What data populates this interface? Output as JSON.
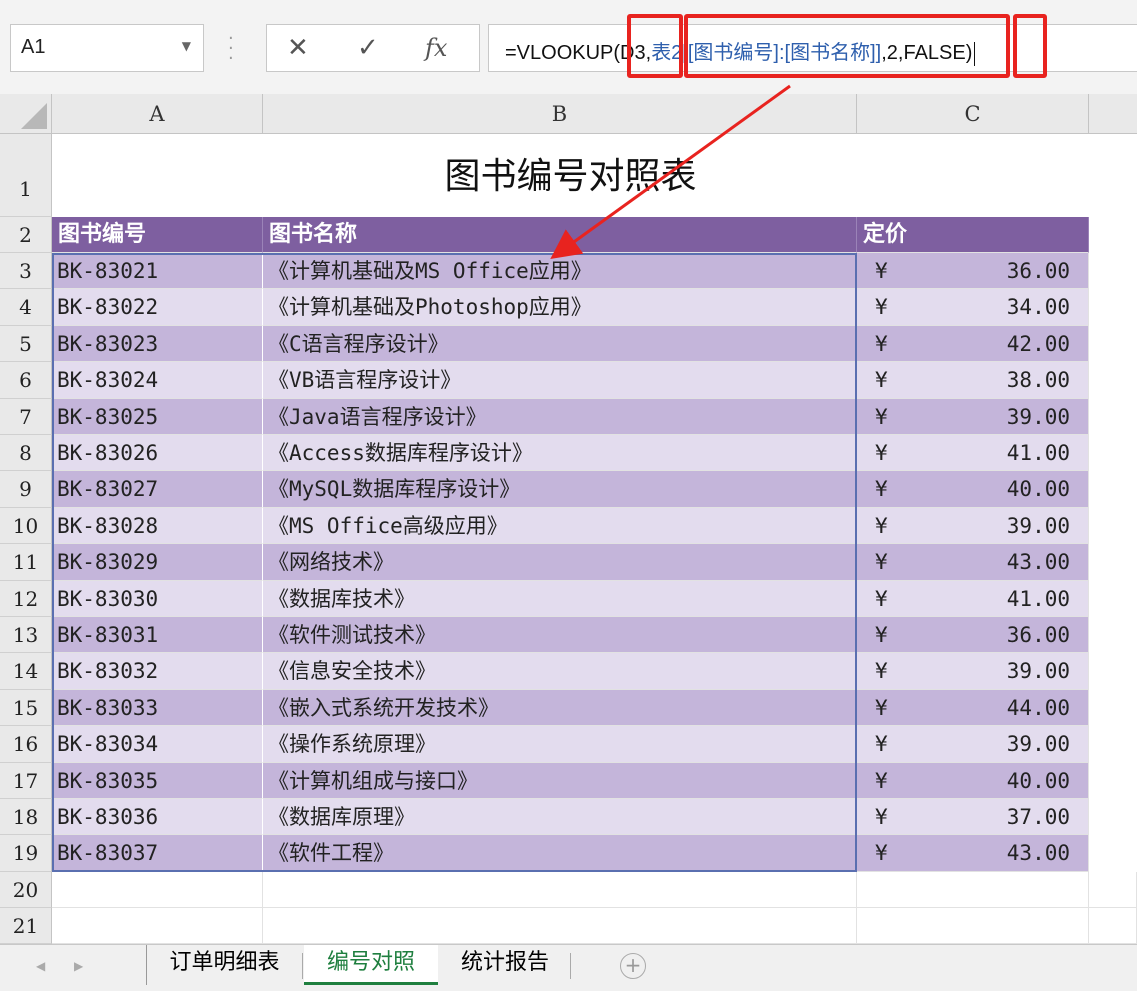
{
  "namebox": {
    "value": "A1",
    "dropdown": "▼"
  },
  "fx_buttons": {
    "cancel": "✕",
    "enter": "✓",
    "fx": "fx"
  },
  "formula": {
    "prefix": "=VLOOKUP(",
    "arg1": "D3",
    "comma1": ",",
    "table": "表2[[图书编号]:[图书名称]]",
    "comma2": ",",
    "arg3": "2",
    "suffix": ",FALSE)"
  },
  "columns": [
    "A",
    "B",
    "C"
  ],
  "row_numbers": [
    "1",
    "2",
    "3",
    "4",
    "5",
    "6",
    "7",
    "8",
    "9",
    "10",
    "11",
    "12",
    "13",
    "14",
    "15",
    "16",
    "17",
    "18",
    "19",
    "20",
    "21"
  ],
  "sheet_title": "图书编号对照表",
  "headers": [
    "图书编号",
    "图书名称",
    "定价"
  ],
  "rows": [
    {
      "id": "BK-83021",
      "name": "《计算机基础及MS Office应用》",
      "currency": "¥",
      "price": "36.00"
    },
    {
      "id": "BK-83022",
      "name": "《计算机基础及Photoshop应用》",
      "currency": "¥",
      "price": "34.00"
    },
    {
      "id": "BK-83023",
      "name": "《C语言程序设计》",
      "currency": "¥",
      "price": "42.00"
    },
    {
      "id": "BK-83024",
      "name": "《VB语言程序设计》",
      "currency": "¥",
      "price": "38.00"
    },
    {
      "id": "BK-83025",
      "name": "《Java语言程序设计》",
      "currency": "¥",
      "price": "39.00"
    },
    {
      "id": "BK-83026",
      "name": "《Access数据库程序设计》",
      "currency": "¥",
      "price": "41.00"
    },
    {
      "id": "BK-83027",
      "name": "《MySQL数据库程序设计》",
      "currency": "¥",
      "price": "40.00"
    },
    {
      "id": "BK-83028",
      "name": "《MS Office高级应用》",
      "currency": "¥",
      "price": "39.00"
    },
    {
      "id": "BK-83029",
      "name": "《网络技术》",
      "currency": "¥",
      "price": "43.00"
    },
    {
      "id": "BK-83030",
      "name": "《数据库技术》",
      "currency": "¥",
      "price": "41.00"
    },
    {
      "id": "BK-83031",
      "name": "《软件测试技术》",
      "currency": "¥",
      "price": "36.00"
    },
    {
      "id": "BK-83032",
      "name": "《信息安全技术》",
      "currency": "¥",
      "price": "39.00"
    },
    {
      "id": "BK-83033",
      "name": "《嵌入式系统开发技术》",
      "currency": "¥",
      "price": "44.00"
    },
    {
      "id": "BK-83034",
      "name": "《操作系统原理》",
      "currency": "¥",
      "price": "39.00"
    },
    {
      "id": "BK-83035",
      "name": "《计算机组成与接口》",
      "currency": "¥",
      "price": "40.00"
    },
    {
      "id": "BK-83036",
      "name": "《数据库原理》",
      "currency": "¥",
      "price": "37.00"
    },
    {
      "id": "BK-83037",
      "name": "《软件工程》",
      "currency": "¥",
      "price": "43.00"
    }
  ],
  "sheet_tabs": [
    {
      "label": "订单明细表",
      "active": false
    },
    {
      "label": "编号对照",
      "active": true
    },
    {
      "label": "统计报告",
      "active": false
    }
  ],
  "colors": {
    "header": "#7e5fa0",
    "band_dark": "#c4b5da",
    "band_light": "#e3dcee",
    "annotation": "#e8231f",
    "table_ref": "#2e5fad"
  }
}
